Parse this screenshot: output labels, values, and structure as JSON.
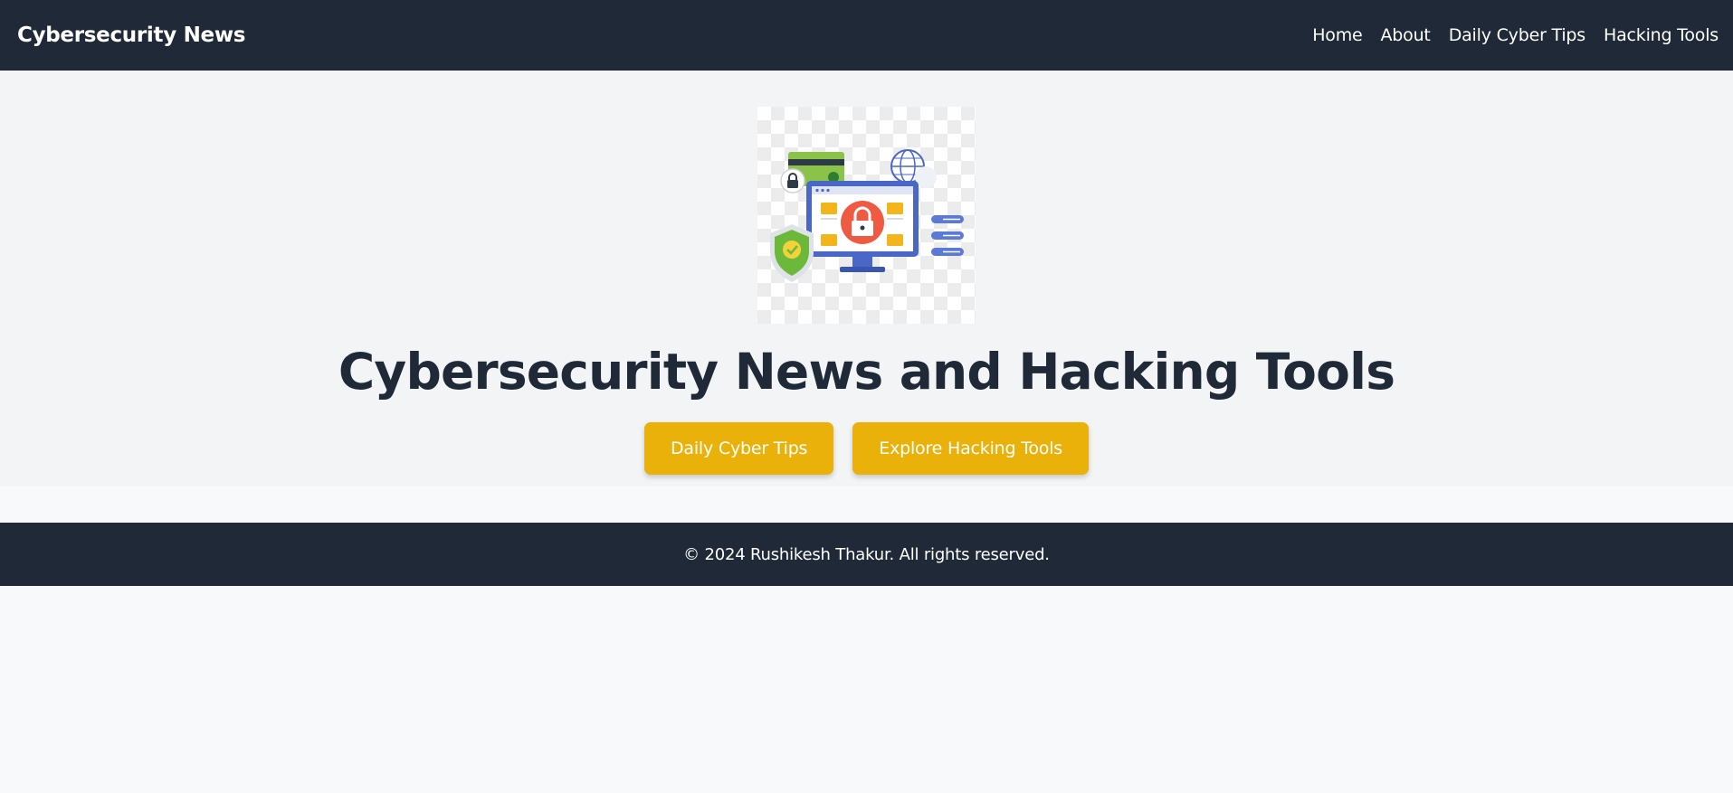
{
  "navbar": {
    "brand": "Cybersecurity News",
    "links": [
      "Home",
      "About",
      "Daily Cyber Tips",
      "Hacking Tools"
    ]
  },
  "hero": {
    "image_icon": "cybersecurity-illustration",
    "title": "Cybersecurity News and Hacking Tools",
    "buttons": [
      "Daily Cyber Tips",
      "Explore Hacking Tools"
    ]
  },
  "footer": {
    "text": "© 2024 Rushikesh Thakur. All rights reserved."
  },
  "colors": {
    "navbar_bg": "#1f2937",
    "hero_bg": "#f3f4f6",
    "button_accent": "#e9b10a",
    "page_bg": "#f8f9fa"
  }
}
